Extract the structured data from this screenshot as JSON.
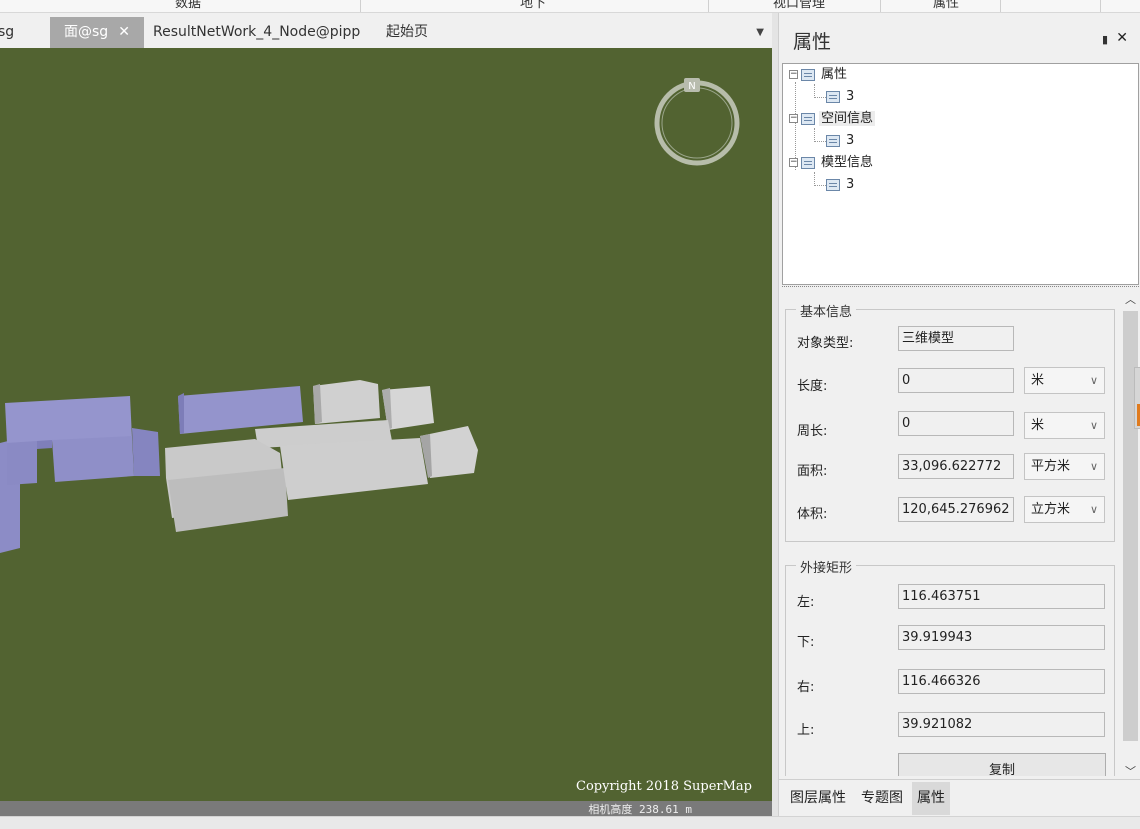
{
  "ribbon": {
    "items": [
      "数据",
      "地下",
      "视口管理",
      "属性"
    ]
  },
  "tabs": {
    "items": [
      {
        "label": "sg",
        "active": false
      },
      {
        "label": "面@sg",
        "active": true
      },
      {
        "label": "ResultNetWork_4_Node@pipp",
        "active": false
      },
      {
        "label": "起始页",
        "active": false
      }
    ],
    "close_glyph": "✕",
    "dropdown_glyph": "▼"
  },
  "viewport": {
    "background": "#526331",
    "compass_letter": "N",
    "copyright": "Copyright 2018 SuperMap",
    "camera_height": "相机高度 238.61 m"
  },
  "panel": {
    "title": "属性",
    "pin_glyph": "📌",
    "close_glyph": "✕",
    "tree": [
      {
        "label": "属性",
        "toggle": "⊟",
        "child": "3"
      },
      {
        "label": "空间信息",
        "toggle": "⊟",
        "child": "3"
      },
      {
        "label": "模型信息",
        "toggle": "⊟",
        "child": "3"
      }
    ],
    "basic": {
      "legend": "基本信息",
      "type_label": "对象类型:",
      "type_value": "三维模型",
      "length_label": "长度:",
      "length_value": "0",
      "length_unit": "米",
      "perimeter_label": "周长:",
      "perimeter_value": "0",
      "perimeter_unit": "米",
      "area_label": "面积:",
      "area_value": "33,096.622772",
      "area_unit": "平方米",
      "volume_label": "体积:",
      "volume_value": "120,645.276962",
      "volume_unit": "立方米"
    },
    "bbox": {
      "legend": "外接矩形",
      "left_label": "左:",
      "left_value": "116.463751",
      "bottom_label": "下:",
      "bottom_value": "39.919943",
      "right_label": "右:",
      "right_value": "116.466326",
      "top_label": "上:",
      "top_value": "39.921082",
      "copy_label": "复制"
    },
    "bottom_tabs": [
      {
        "label": "图层属性",
        "active": false
      },
      {
        "label": "专题图",
        "active": false
      },
      {
        "label": "属性",
        "active": true
      }
    ]
  },
  "colors": {
    "purple_building": "#8f8fc9",
    "grey_building": "#c8c8c8",
    "accent_orange": "#e07b1e"
  }
}
